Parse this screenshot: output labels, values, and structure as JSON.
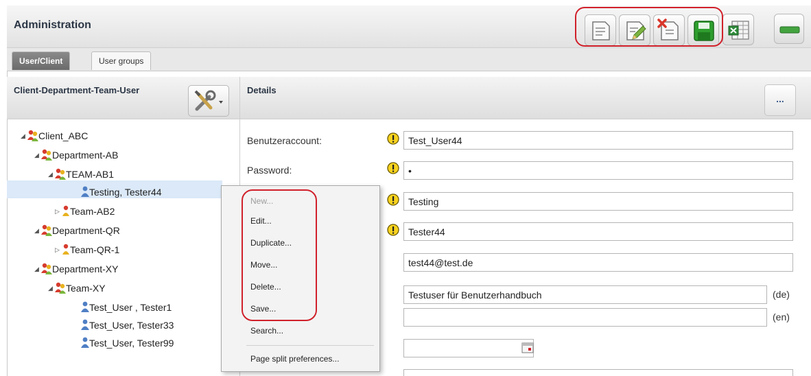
{
  "header": {
    "title": "Administration",
    "toolbar": {
      "new_icon": "new-document-icon",
      "edit_icon": "edit-document-icon",
      "delete_icon": "delete-document-icon",
      "save_icon": "save-icon",
      "excel_icon": "excel-export-icon",
      "minimize_icon": "minimize-icon"
    }
  },
  "tabs": [
    {
      "label": "User/Client",
      "active": true
    },
    {
      "label": "User groups",
      "active": false
    }
  ],
  "left_panel": {
    "title": "Client-Department-Team-User",
    "tools_icon": "tools-icon",
    "tree": [
      {
        "label": "Client_ABC",
        "expanded": true
      },
      {
        "label": "Department-AB",
        "expanded": true
      },
      {
        "label": "TEAM-AB1",
        "expanded": true
      },
      {
        "label": "Testing, Tester44",
        "selected": true
      },
      {
        "label": "Team-AB2",
        "expanded": false
      },
      {
        "label": "Department-QR",
        "expanded": true
      },
      {
        "label": "Team-QR-1",
        "expanded": false
      },
      {
        "label": "Department-XY",
        "expanded": true
      },
      {
        "label": "Team-XY",
        "expanded": true
      },
      {
        "label": "Test_User , Tester1"
      },
      {
        "label": "Test_User, Tester33"
      },
      {
        "label": "Test_User, Tester99"
      }
    ]
  },
  "context_menu": {
    "items": [
      {
        "label": "New...",
        "enabled": false
      },
      {
        "label": "Edit...",
        "enabled": true
      },
      {
        "label": "Duplicate...",
        "enabled": true
      },
      {
        "label": "Move...",
        "enabled": true
      },
      {
        "label": "Delete...",
        "enabled": true
      },
      {
        "label": "Save...",
        "enabled": true
      },
      {
        "label": "Search...",
        "enabled": true
      },
      {
        "label": "Page split preferences...",
        "enabled": true
      }
    ]
  },
  "details": {
    "title": "Details",
    "more_label": "...",
    "fields": {
      "account_label": "Benutzeraccount:",
      "account_value": "Test_User44",
      "password_label": "Password:",
      "password_value": "•",
      "lastname_value": "Testing",
      "firstname_value": "Tester44",
      "email_value": "test44@test.de",
      "description_de_value": "Testuser für Benutzerhandbuch",
      "description_de_lang": "(de)",
      "description_en_value": "",
      "description_en_lang": "(en)",
      "date_value": ""
    }
  },
  "colors": {
    "highlight_red": "#d0202a",
    "selection": "#dbe9f8",
    "title_text": "#2b3645"
  }
}
